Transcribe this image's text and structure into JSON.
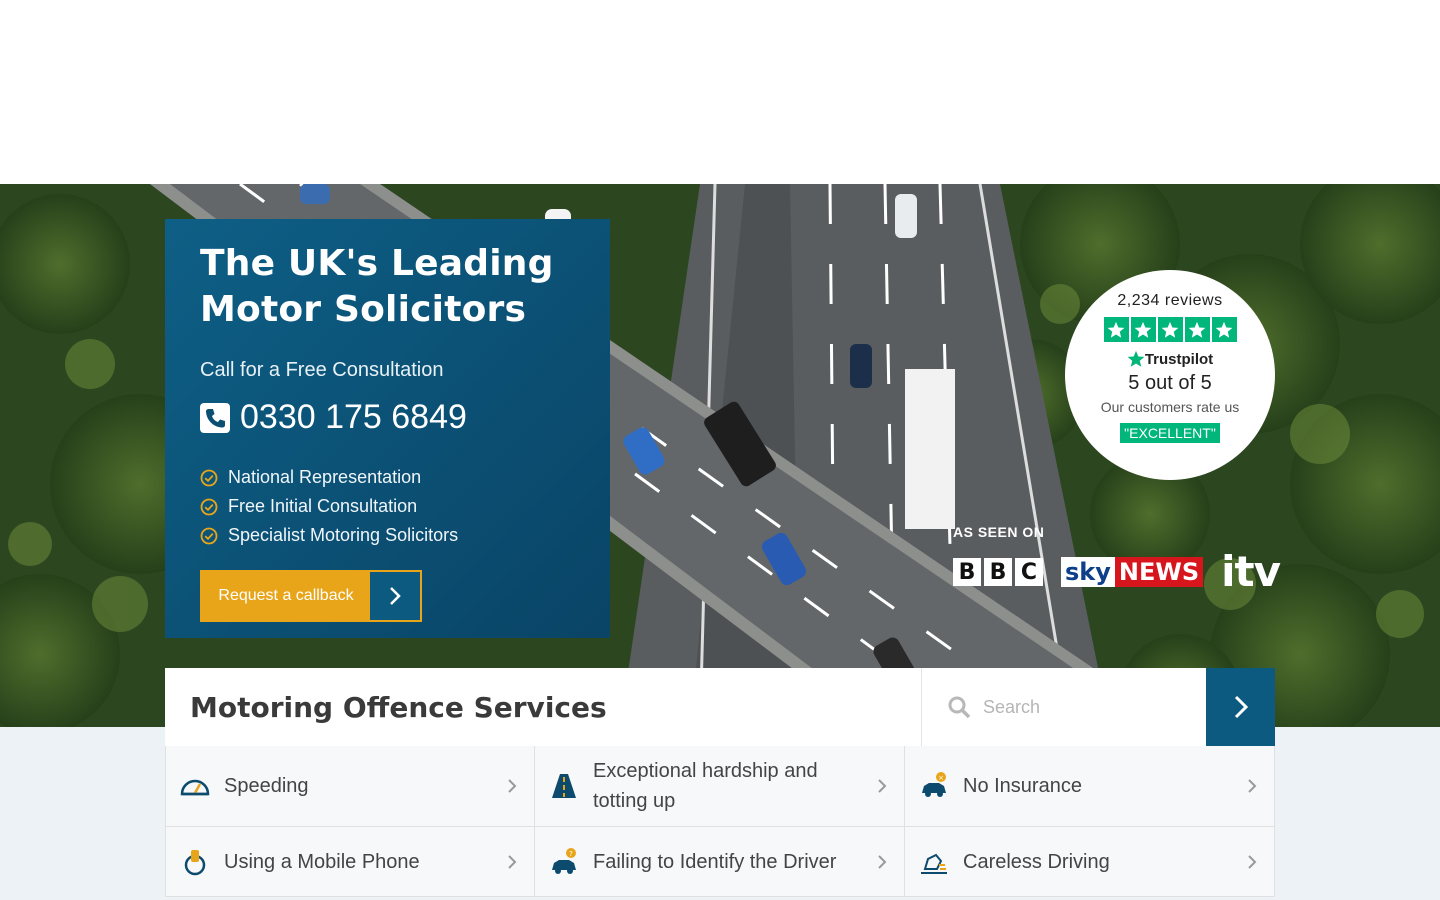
{
  "hero": {
    "title_line1": "The UK's Leading",
    "title_line2": "Motor Solicitors",
    "subtitle": "Call for a Free Consultation",
    "phone": "0330 175 6849",
    "features": [
      "National Representation",
      "Free Initial Consultation",
      "Specialist Motoring Solicitors"
    ],
    "callback_label": "Request a callback"
  },
  "trustpilot": {
    "reviews": "2,234 reviews",
    "brand": "Trustpilot",
    "rating": "5 out of 5",
    "rate_us": "Our customers rate us",
    "badge": "\"EXCELLENT\"",
    "stars": 5
  },
  "as_seen_on": {
    "label": "AS SEEN ON",
    "bbc": [
      "B",
      "B",
      "C"
    ],
    "sky": "sky",
    "news": "NEWS",
    "itv": "itv"
  },
  "services": {
    "title": "Motoring Offence Services",
    "search_placeholder": "Search",
    "items": [
      {
        "label": "Speeding",
        "icon": "speedometer-icon"
      },
      {
        "label": "Exceptional hardship and totting up",
        "icon": "road-icon"
      },
      {
        "label": "No Insurance",
        "icon": "car-insurance-icon"
      },
      {
        "label": "Using a Mobile Phone",
        "icon": "mobile-phone-icon"
      },
      {
        "label": "Failing to Identify the Driver",
        "icon": "car-unknown-driver-icon"
      },
      {
        "label": "Careless Driving",
        "icon": "careless-driving-icon"
      }
    ]
  },
  "colors": {
    "brand_blue": "#0d5a80",
    "accent_yellow": "#e8a51a",
    "trustpilot_green": "#00b67a",
    "sky_red": "#d6151d"
  }
}
